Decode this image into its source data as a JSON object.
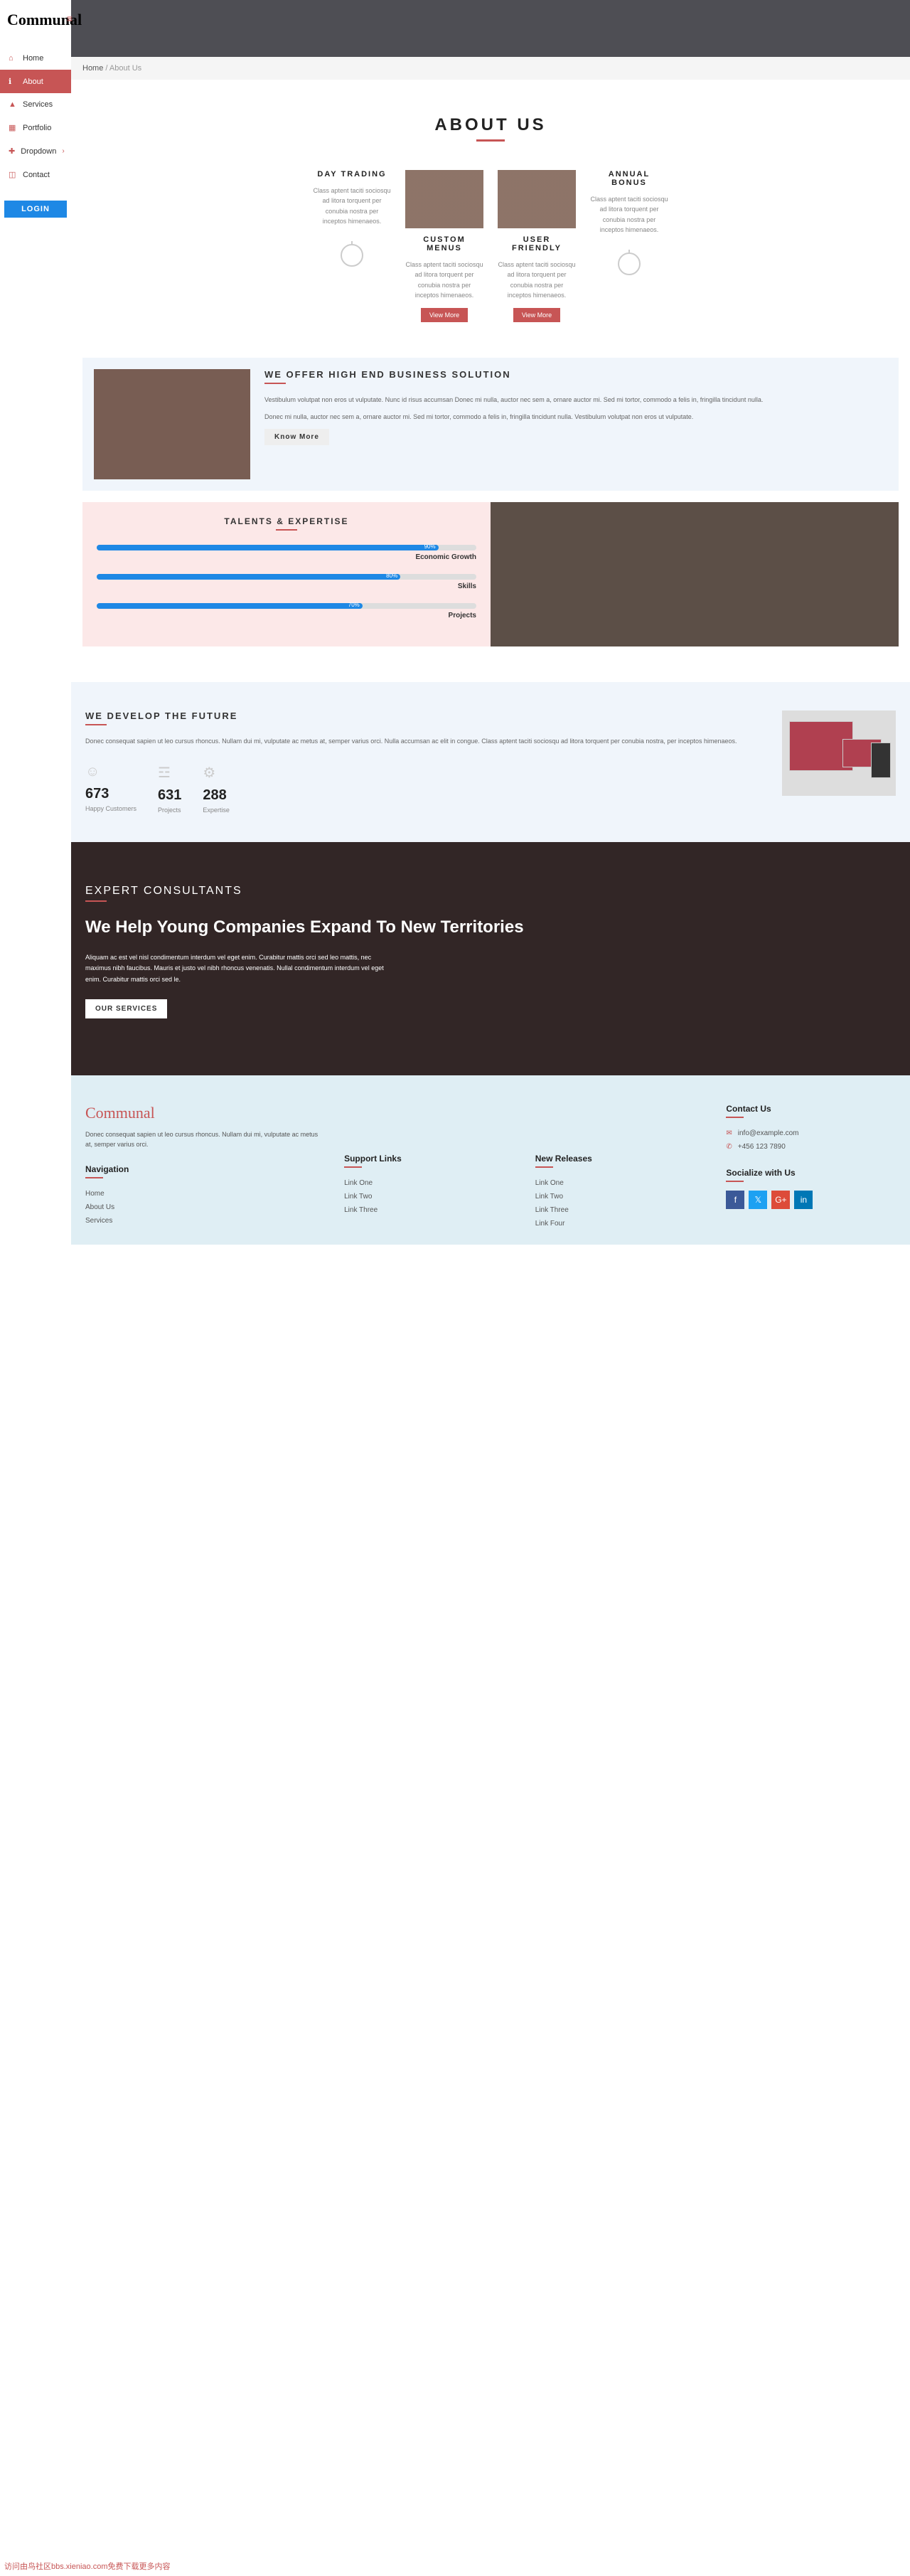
{
  "brand": "Communal",
  "login": "LOGIN",
  "nav": [
    {
      "icon": "⌂",
      "label": "Home",
      "active": false
    },
    {
      "icon": "ℹ",
      "label": "About",
      "active": true
    },
    {
      "icon": "▲",
      "label": "Services",
      "active": false
    },
    {
      "icon": "▦",
      "label": "Portfolio",
      "active": false
    },
    {
      "icon": "✚",
      "label": "Dropdown",
      "active": false,
      "chevron": true
    },
    {
      "icon": "◫",
      "label": "Contact",
      "active": false
    }
  ],
  "breadcrumb": {
    "home": "Home",
    "current": "About Us"
  },
  "about": {
    "title": "ABOUT US",
    "features": [
      {
        "title": "DAY TRADING",
        "text": "Class aptent taciti sociosqu ad litora torquent per conubia nostra per inceptos himenaeos.",
        "hasImg": false,
        "hasIcon": true
      },
      {
        "title": "CUSTOM MENUS",
        "text": "Class aptent taciti sociosqu ad litora torquent per conubia nostra per inceptos himenaeos.",
        "hasImg": true,
        "viewMore": "View More"
      },
      {
        "title": "USER FRIENDLY",
        "text": "Class aptent taciti sociosqu ad litora torquent per conubia nostra per inceptos himenaeos.",
        "hasImg": true,
        "viewMore": "View More"
      },
      {
        "title": "ANNUAL BONUS",
        "text": "Class aptent taciti sociosqu ad litora torquent per conubia nostra per inceptos himenaeos.",
        "hasImg": false,
        "hasIcon": true
      }
    ]
  },
  "solution": {
    "title": "WE OFFER HIGH END BUSINESS SOLUTION",
    "p1": "Vestibulum volutpat non eros ut vulputate. Nunc id risus accumsan Donec mi nulla, auctor nec sem a, ornare auctor mi. Sed mi tortor, commodo a felis in, fringilla tincidunt nulla.",
    "p2": "Donec mi nulla, auctor nec sem a, ornare auctor mi. Sed mi tortor, commodo a felis in, fringilla tincidunt nulla. Vestibulum volutpat non eros ut vulputate.",
    "btn": "Know More"
  },
  "talents": {
    "title": "TALENTS & EXPERTISE",
    "skills": [
      {
        "label": "Economic Growth",
        "pct": 90
      },
      {
        "label": "Skills",
        "pct": 80
      },
      {
        "label": "Projects",
        "pct": 70
      }
    ]
  },
  "develop": {
    "title": "WE DEVELOP THE FUTURE",
    "text": "Donec consequat sapien ut leo cursus rhoncus. Nullam dui mi, vulputate ac metus at, semper varius orci. Nulla accumsan ac elit in congue. Class aptent taciti sociosqu ad litora torquent per conubia nostra, per inceptos himenaeos.",
    "stats": [
      {
        "icon": "☺",
        "num": "673",
        "label": "Happy Customers"
      },
      {
        "icon": "☲",
        "num": "631",
        "label": "Projects"
      },
      {
        "icon": "⚙",
        "num": "288",
        "label": "Expertise"
      }
    ]
  },
  "consultants": {
    "label": "EXPERT CONSULTANTS",
    "title": "We Help Young Companies Expand To New Territories",
    "text": "Aliquam ac est vel nisl condimentum interdum vel eget enim. Curabitur mattis orci sed leo mattis, nec maximus nibh faucibus. Mauris et justo vel nibh rhoncus venenatis. Nullal condimentum interdum vel eget enim. Curabitur mattis orci sed le.",
    "btn": "OUR SERVICES"
  },
  "footer": {
    "logo": "Communal",
    "about": "Donec consequat sapien ut leo cursus rhoncus. Nullam dui mi, vulputate ac metus at, semper varius orci.",
    "navHeading": "Navigation",
    "navLinks": [
      "Home",
      "About Us",
      "Services"
    ],
    "supportHeading": "Support Links",
    "supportLinks": [
      "Link One",
      "Link Two",
      "Link Three"
    ],
    "releasesHeading": "New Releases",
    "releasesLinks": [
      "Link One",
      "Link Two",
      "Link Three",
      "Link Four"
    ],
    "contactHeading": "Contact Us",
    "email": "info@example.com",
    "phone": "+456 123 7890",
    "socialHeading": "Socialize with Us"
  },
  "chart_data": {
    "type": "bar",
    "title": "TALENTS & EXPERTISE",
    "categories": [
      "Economic Growth",
      "Skills",
      "Projects"
    ],
    "values": [
      90,
      80,
      70
    ],
    "xlim": [
      0,
      100
    ],
    "xlabel": "%",
    "ylabel": ""
  },
  "watermark": "访问由鸟社区bbs.xieniao.com免费下载更多内容"
}
